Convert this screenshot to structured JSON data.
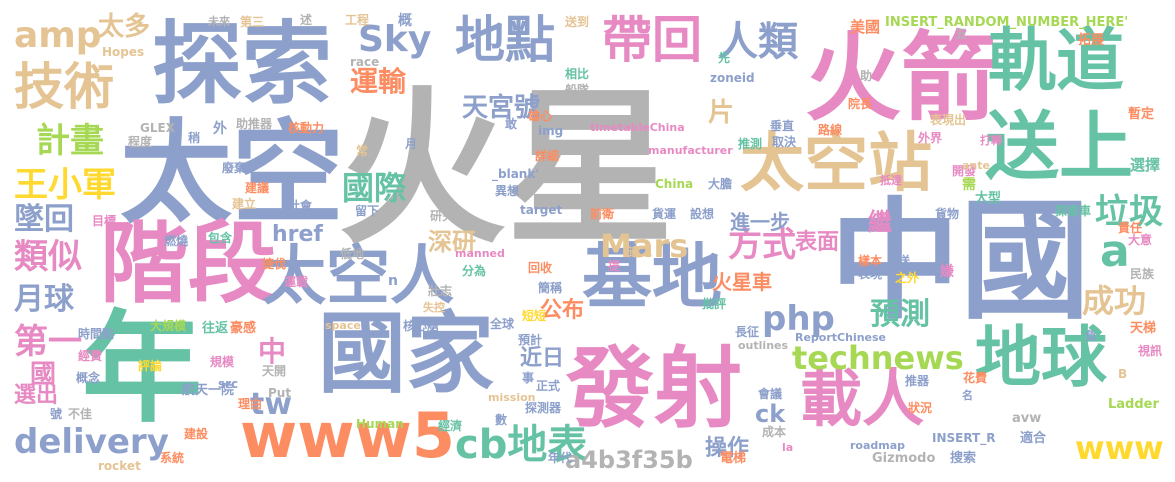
{
  "palette": {
    "gray": "#b3b3b3",
    "pink": "#e78ac3",
    "blue": "#8da0cb",
    "green": "#66c2a5",
    "orange": "#fc8d62",
    "lime": "#a6d854",
    "tan": "#e5c494",
    "yellow": "#ffd92f"
  },
  "words": [
    {
      "text": "火星",
      "c": "gray",
      "big": true
    },
    {
      "text": "中國",
      "c": "blue"
    },
    {
      "text": "太空",
      "c": "blue"
    },
    {
      "text": "探索",
      "c": "blue"
    },
    {
      "text": "階段",
      "c": "pink"
    },
    {
      "text": "火箭",
      "c": "pink"
    },
    {
      "text": "軌道",
      "c": "green"
    },
    {
      "text": "送上",
      "c": "green"
    },
    {
      "text": "太空站",
      "c": "tan"
    },
    {
      "text": "年",
      "c": "green"
    },
    {
      "text": "國家",
      "c": "blue"
    },
    {
      "text": "發射",
      "c": "pink"
    },
    {
      "text": "地球",
      "c": "green"
    },
    {
      "text": "載人",
      "c": "pink"
    },
    {
      "text": "太空人",
      "c": "blue"
    },
    {
      "text": "基地",
      "c": "blue"
    },
    {
      "text": "地點",
      "c": "blue"
    },
    {
      "text": "帶回",
      "c": "pink"
    },
    {
      "text": "人類",
      "c": "blue"
    },
    {
      "text": "技術",
      "c": "tan"
    },
    {
      "text": "amp",
      "c": "tan"
    },
    {
      "text": "太多",
      "c": "tan"
    },
    {
      "text": "Sky",
      "c": "blue"
    },
    {
      "text": "運輸",
      "c": "orange"
    },
    {
      "text": "天宮號",
      "c": "blue"
    },
    {
      "text": "計畫",
      "c": "lime"
    },
    {
      "text": "王小軍",
      "c": "yellow"
    },
    {
      "text": "墜回",
      "c": "blue"
    },
    {
      "text": "類似",
      "c": "pink"
    },
    {
      "text": "月球",
      "c": "blue"
    },
    {
      "text": "國際",
      "c": "green"
    },
    {
      "text": "深研",
      "c": "tan"
    },
    {
      "text": "href",
      "c": "blue"
    },
    {
      "text": "Mars",
      "c": "tan"
    },
    {
      "text": "方式",
      "c": "pink"
    },
    {
      "text": "php",
      "c": "blue"
    },
    {
      "text": "technews",
      "c": "lime"
    },
    {
      "text": "預測",
      "c": "green"
    },
    {
      "text": "成功",
      "c": "tan"
    },
    {
      "text": "垃圾",
      "c": "green"
    },
    {
      "text": "a",
      "c": "green"
    },
    {
      "text": "delivery",
      "c": "blue"
    },
    {
      "text": "www5",
      "c": "orange"
    },
    {
      "text": "cb地表",
      "c": "green"
    },
    {
      "text": "www",
      "c": "yellow"
    },
    {
      "text": "tw",
      "c": "blue"
    },
    {
      "text": "第一",
      "c": "pink"
    },
    {
      "text": "a4b3f35b",
      "c": "gray"
    },
    {
      "text": "操作",
      "c": "blue"
    },
    {
      "text": "中",
      "c": "pink"
    },
    {
      "text": "選出",
      "c": "pink"
    },
    {
      "text": "國",
      "c": "pink"
    },
    {
      "text": "公布",
      "c": "orange"
    },
    {
      "text": "近日",
      "c": "blue"
    },
    {
      "text": "火星車",
      "c": "orange"
    },
    {
      "text": "表面",
      "c": "pink"
    },
    {
      "text": "進一步",
      "c": "blue"
    },
    {
      "text": "繼",
      "c": "pink"
    },
    {
      "text": "片",
      "c": "tan"
    },
    {
      "text": "ck",
      "c": "blue"
    },
    {
      "text": "INSERT_RANDOM_NUMBER_HERE'",
      "c": "lime"
    },
    {
      "text": "美國",
      "c": "orange"
    },
    {
      "text": "拓展",
      "c": "orange"
    },
    {
      "text": "暫定",
      "c": "orange"
    },
    {
      "text": "選擇",
      "c": "green"
    },
    {
      "text": "大型",
      "c": "green"
    },
    {
      "text": "探索車",
      "c": "green"
    },
    {
      "text": "責任",
      "c": "orange"
    },
    {
      "text": "大意",
      "c": "pink"
    },
    {
      "text": "天梯",
      "c": "orange"
    },
    {
      "text": "Ladder",
      "c": "lime"
    },
    {
      "text": "avw",
      "c": "gray"
    },
    {
      "text": "適合",
      "c": "blue"
    },
    {
      "text": "Gizmodo",
      "c": "gray"
    },
    {
      "text": "搜索",
      "c": "blue"
    },
    {
      "text": "電梯",
      "c": "orange"
    },
    {
      "text": "年代",
      "c": "blue"
    },
    {
      "text": "成本",
      "c": "gray"
    },
    {
      "text": "Human",
      "c": "lime"
    },
    {
      "text": "rocket",
      "c": "tan"
    },
    {
      "text": "系統",
      "c": "orange"
    },
    {
      "text": "建設",
      "c": "orange"
    },
    {
      "text": "航天一院",
      "c": "blue"
    },
    {
      "text": "評論",
      "c": "yellow"
    },
    {
      "text": "經費",
      "c": "pink"
    },
    {
      "text": "時間點",
      "c": "blue"
    },
    {
      "text": "大規模",
      "c": "lime"
    },
    {
      "text": "往返",
      "c": "green"
    },
    {
      "text": "豪感",
      "c": "orange"
    },
    {
      "text": "核心艙",
      "c": "blue"
    },
    {
      "text": "全球",
      "c": "blue"
    },
    {
      "text": "預計",
      "c": "blue"
    },
    {
      "text": "短短",
      "c": "yellow"
    },
    {
      "text": "回收",
      "c": "orange"
    },
    {
      "text": "簡稱",
      "c": "blue"
    },
    {
      "text": "分為",
      "c": "green"
    },
    {
      "text": "壯志",
      "c": "gray"
    },
    {
      "text": "運載",
      "c": "pink"
    },
    {
      "text": "低地",
      "c": "gray"
    },
    {
      "text": "包含",
      "c": "green"
    },
    {
      "text": "捷伐",
      "c": "orange"
    },
    {
      "text": "燃燒",
      "c": "blue"
    },
    {
      "text": "目標",
      "c": "pink"
    },
    {
      "text": "建立",
      "c": "tan"
    },
    {
      "text": "社會",
      "c": "blue"
    },
    {
      "text": "留下",
      "c": "blue"
    },
    {
      "text": "研究",
      "c": "gray"
    },
    {
      "text": "建議",
      "c": "orange"
    },
    {
      "text": "廢棄",
      "c": "blue"
    },
    {
      "text": "核動力",
      "c": "orange"
    },
    {
      "text": "助推器",
      "c": "gray"
    },
    {
      "text": "GLEX",
      "c": "gray"
    },
    {
      "text": "稍",
      "c": "blue"
    },
    {
      "text": "程度",
      "c": "gray"
    },
    {
      "text": "外",
      "c": "blue"
    },
    {
      "text": "Hopes",
      "c": "tan"
    },
    {
      "text": "第三",
      "c": "tan"
    },
    {
      "text": "未來",
      "c": "gray"
    },
    {
      "text": "述",
      "c": "gray"
    },
    {
      "text": "工程",
      "c": "tan"
    },
    {
      "text": "概",
      "c": "blue"
    },
    {
      "text": "race",
      "c": "gray"
    },
    {
      "text": "送到",
      "c": "tan"
    },
    {
      "text": "相比",
      "c": "green"
    },
    {
      "text": "船隊",
      "c": "gray"
    },
    {
      "text": "雄心",
      "c": "orange"
    },
    {
      "text": "img",
      "c": "blue"
    },
    {
      "text": "敢",
      "c": "blue"
    },
    {
      "text": "timetableChina",
      "c": "pink"
    },
    {
      "text": "manufacturer",
      "c": "pink"
    },
    {
      "text": "常",
      "c": "tan"
    },
    {
      "text": "月",
      "c": "blue"
    },
    {
      "text": "詳細",
      "c": "orange"
    },
    {
      "text": "_blank'",
      "c": "blue"
    },
    {
      "text": "異想",
      "c": "blue"
    },
    {
      "text": "target",
      "c": "blue"
    },
    {
      "text": "China",
      "c": "lime"
    },
    {
      "text": "大膽",
      "c": "blue"
    },
    {
      "text": "前衛",
      "c": "orange"
    },
    {
      "text": "貨運",
      "c": "blue"
    },
    {
      "text": "設想",
      "c": "blue"
    },
    {
      "text": "zoneid",
      "c": "blue"
    },
    {
      "text": "推測",
      "c": "green"
    },
    {
      "text": "取決",
      "c": "blue"
    },
    {
      "text": "路線",
      "c": "orange"
    },
    {
      "text": "院長",
      "c": "orange"
    },
    {
      "text": "垂直",
      "c": "blue"
    },
    {
      "text": "表現出",
      "c": "tan"
    },
    {
      "text": "外界",
      "c": "pink"
    },
    {
      "text": "開發",
      "c": "pink"
    },
    {
      "text": "打轉",
      "c": "pink"
    },
    {
      "text": "抵達",
      "c": "pink"
    },
    {
      "text": "需",
      "c": "lime"
    },
    {
      "text": "ante",
      "c": "tan"
    },
    {
      "text": "貨物",
      "c": "blue"
    },
    {
      "text": "樣本",
      "c": "orange"
    },
    {
      "text": "表現",
      "c": "blue"
    },
    {
      "text": "送",
      "c": "blue"
    },
    {
      "text": "之外",
      "c": "yellow"
    },
    {
      "text": "嫌",
      "c": "pink"
    },
    {
      "text": "民族",
      "c": "gray"
    },
    {
      "text": "負",
      "c": "blue"
    },
    {
      "text": "ReportChinese",
      "c": "blue"
    },
    {
      "text": "outlines",
      "c": "gray"
    },
    {
      "text": "長征",
      "c": "blue"
    },
    {
      "text": "批評",
      "c": "green"
    },
    {
      "text": "會議",
      "c": "blue"
    },
    {
      "text": "推器",
      "c": "blue"
    },
    {
      "text": "花費",
      "c": "orange"
    },
    {
      "text": "狀況",
      "c": "orange"
    },
    {
      "text": "名",
      "c": "blue"
    },
    {
      "text": "視訊",
      "c": "pink"
    },
    {
      "text": "INSERT_R",
      "c": "blue"
    },
    {
      "text": "roadmap",
      "c": "blue"
    },
    {
      "text": "B",
      "c": "tan"
    },
    {
      "text": "la",
      "c": "pink"
    },
    {
      "text": "提",
      "c": "pink"
    },
    {
      "text": "遙二",
      "c": "tan"
    },
    {
      "text": "manned",
      "c": "pink"
    },
    {
      "text": "失控",
      "c": "tan"
    },
    {
      "text": "space",
      "c": "tan"
    },
    {
      "text": "mission",
      "c": "tan"
    },
    {
      "text": "事",
      "c": "blue"
    },
    {
      "text": "正式",
      "c": "blue"
    },
    {
      "text": "探測器",
      "c": "blue"
    },
    {
      "text": "經濟",
      "c": "green"
    },
    {
      "text": "數",
      "c": "blue"
    },
    {
      "text": "src",
      "c": "blue"
    },
    {
      "text": "Put",
      "c": "gray"
    },
    {
      "text": "天開",
      "c": "gray"
    },
    {
      "text": "理由",
      "c": "orange"
    },
    {
      "text": "規模",
      "c": "pink"
    },
    {
      "text": "概念",
      "c": "blue"
    },
    {
      "text": "號",
      "c": "blue"
    },
    {
      "text": "不佳",
      "c": "gray"
    },
    {
      "text": "五",
      "c": "gray"
    },
    {
      "text": "先",
      "c": "green"
    },
    {
      "text": "助",
      "c": "gray"
    },
    {
      "text": "n",
      "c": "blue"
    }
  ]
}
